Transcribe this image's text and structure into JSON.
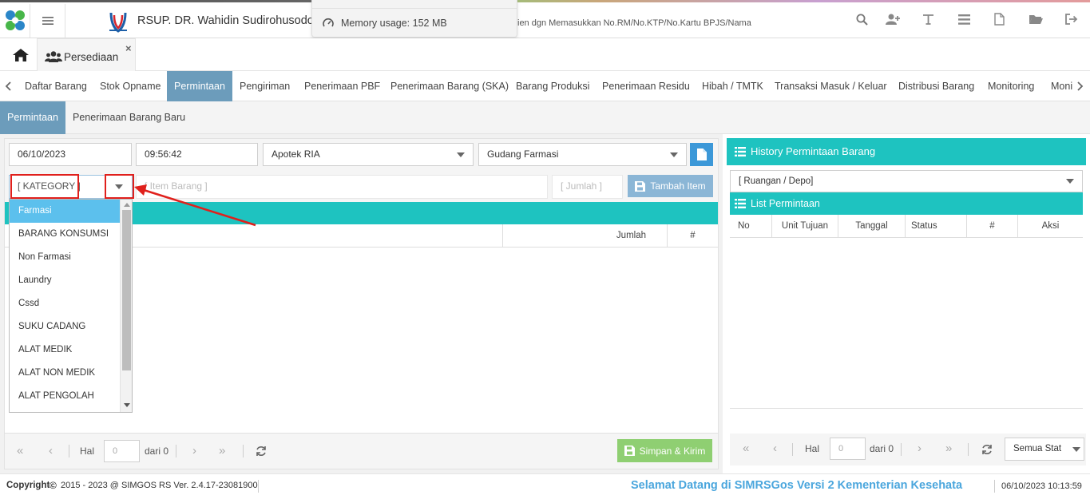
{
  "header": {
    "hospital_name": "RSUP. DR. Wahidin Sudirohusodo",
    "memory_popup": "Memory usage: 152 MB",
    "search_hint": "ien dgn Memasukkan No.RM/No.KTP/No.Kartu BPJS/Nama",
    "icons": [
      "search-icon",
      "add-user-icon",
      "text-icon",
      "list-icon",
      "pdf-icon",
      "folder-open-icon",
      "logout-icon"
    ]
  },
  "tabs": {
    "home_icon": "home-icon",
    "open_tab_label": "Persediaan",
    "close_symbol": "×"
  },
  "nav": {
    "items": [
      "Daftar Barang",
      "Stok Opname",
      "Permintaan",
      "Pengiriman",
      "Penerimaan PBF",
      "Penerimaan Barang (SKA)",
      "Barang Produksi",
      "Penerimaan Residu",
      "Hibah / TMTK",
      "Transaksi Masuk / Keluar",
      "Distribusi Barang",
      "Monitoring",
      "Moni"
    ],
    "active_index": 2
  },
  "subtabs": {
    "items": [
      "Permintaan",
      "Penerimaan Barang Baru"
    ],
    "active_index": 0
  },
  "form": {
    "date": "06/10/2023",
    "time": "09:56:42",
    "source": "Apotek RIA",
    "destination": "Gudang Farmasi",
    "category_placeholder": "[ KATEGORY ]",
    "item_placeholder": "[ Item Barang ]",
    "qty_placeholder": "[ Jumlah ]",
    "add_button": "Tambah Item"
  },
  "items_table": {
    "columns": [
      "Jumlah",
      "#"
    ]
  },
  "category_dropdown": {
    "options": [
      "Farmasi",
      "BARANG KONSUMSI",
      "Non Farmasi",
      "Laundry",
      "Cssd",
      "SUKU CADANG",
      "ALAT MEDIK",
      "ALAT NON MEDIK",
      "ALAT PENGOLAH"
    ],
    "selected_index": 0
  },
  "left_pager": {
    "hal_label": "Hal",
    "page_value": "0",
    "of_label": "dari 0",
    "save_button": "Simpan & Kirim"
  },
  "history": {
    "title": "History Permintaan Barang",
    "room_placeholder": "[ Ruangan / Depo]",
    "list_title": "List Permintaan",
    "columns": [
      "No",
      "Unit Tujuan",
      "Tanggal",
      "Status",
      "#",
      "Aksi"
    ],
    "pager": {
      "hal_label": "Hal",
      "page_value": "0",
      "of_label": "dari 0",
      "status_filter": "Semua Stat"
    }
  },
  "footer": {
    "copyright_label": "Copyright",
    "copyright_text": "2015 - 2023 @ SIMGOS RS Ver. 2.4.17-23081900",
    "marquee": "Selamat Datang di SIMRSGos Versi 2 Kementerian Kesehata",
    "datetime": "06/10/2023 10:13:59"
  },
  "colors": {
    "teal": "#1ec3c0",
    "active_tab": "#6c9cbb",
    "dropdown_selected": "#5cc0ed",
    "annotation_red": "#e0201c",
    "save_green": "#8fcf72",
    "add_blue": "#8bb6d6"
  }
}
